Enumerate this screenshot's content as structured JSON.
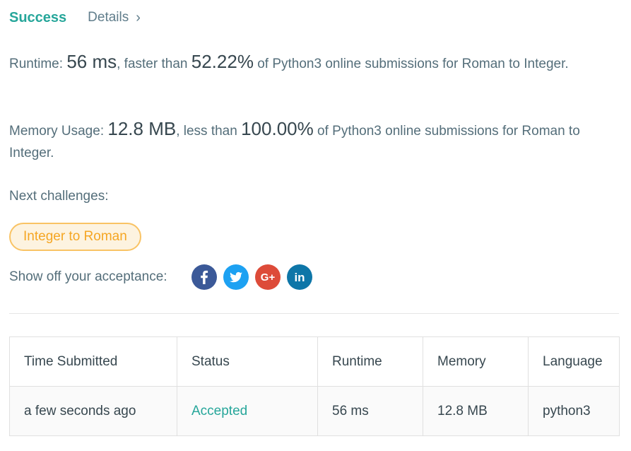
{
  "header": {
    "status": "Success",
    "details_label": "Details",
    "chevron": "›"
  },
  "runtime": {
    "label": "Runtime: ",
    "value": "56 ms",
    "mid": ", faster than ",
    "percent": "52.22%",
    "suffix": " of Python3 online submissions for Roman to Integer."
  },
  "memory": {
    "label": "Memory Usage: ",
    "value": "12.8 MB",
    "mid": ", less than ",
    "percent": "100.00%",
    "suffix": " of Python3 online submissions for Roman to Integer."
  },
  "next": {
    "label": "Next challenges:",
    "challenge": "Integer to Roman"
  },
  "share": {
    "label": "Show off your acceptance:",
    "networks": [
      {
        "icon": "facebook-icon",
        "color": "#3b5998",
        "glyph": "f"
      },
      {
        "icon": "twitter-icon",
        "color": "#1da1f2",
        "glyph": "t"
      },
      {
        "icon": "google-plus-icon",
        "color": "#dd4b39",
        "glyph": "G+"
      },
      {
        "icon": "linkedin-icon",
        "color": "#0e76a8",
        "glyph": "in"
      }
    ]
  },
  "table": {
    "headers": [
      "Time Submitted",
      "Status",
      "Runtime",
      "Memory",
      "Language"
    ],
    "rows": [
      {
        "time": "a few seconds ago",
        "status": "Accepted",
        "runtime": "56 ms",
        "memory": "12.8 MB",
        "language": "python3"
      }
    ]
  },
  "colors": {
    "success": "#26a69a",
    "challenge_border": "#f9c364",
    "challenge_text": "#f5a623"
  }
}
